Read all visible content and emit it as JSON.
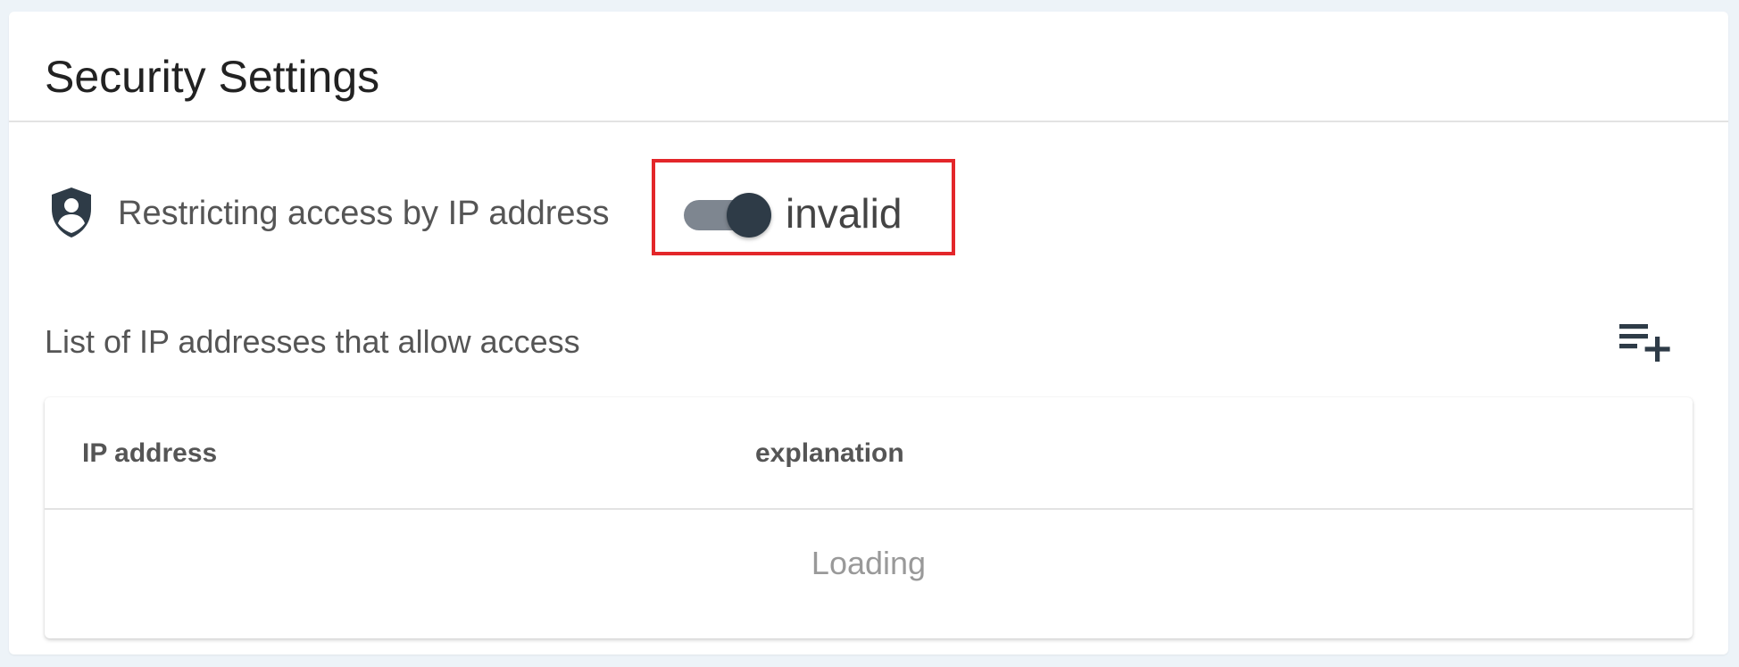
{
  "card": {
    "title": "Security Settings"
  },
  "ip_restriction": {
    "icon": "admin-shield-icon",
    "label": "Restricting access by IP address",
    "toggle_on": true,
    "state_text": "invalid",
    "highlight_color": "#e3262a"
  },
  "allowlist": {
    "heading": "List of IP addresses that allow access",
    "add_icon": "playlist-add-icon",
    "columns": [
      "IP address",
      "explanation"
    ],
    "status_text": "Loading"
  },
  "colors": {
    "page_background": "#edf3f8",
    "toggle_thumb": "#2e3b47",
    "toggle_track": "#7e8690",
    "icon": "#2e3b47"
  }
}
